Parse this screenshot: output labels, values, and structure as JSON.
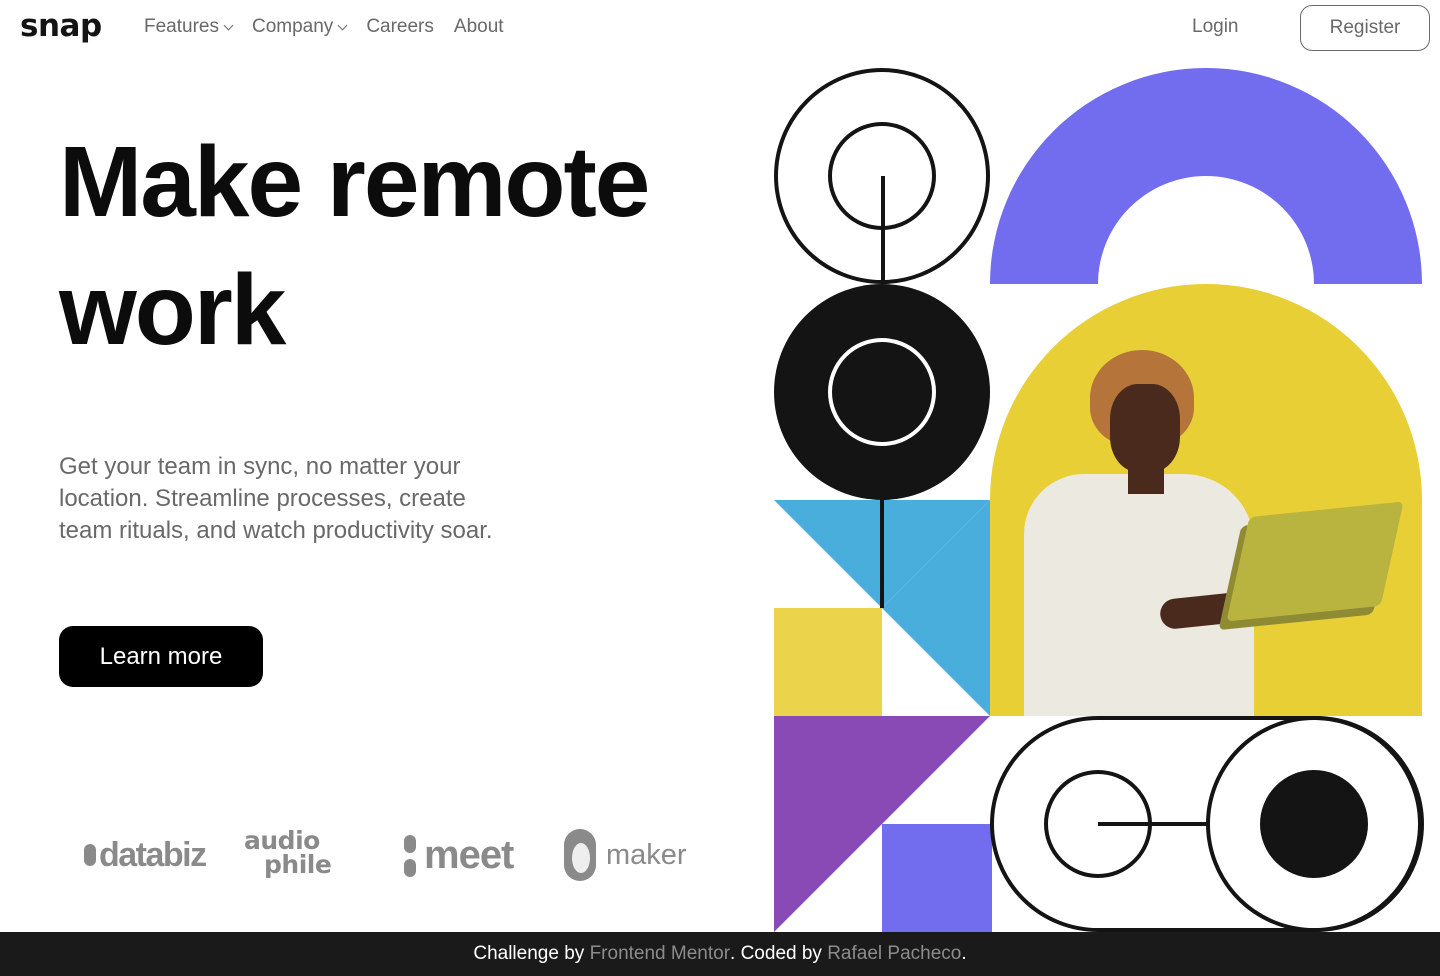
{
  "header": {
    "logo": "snap",
    "nav": [
      {
        "label": "Features",
        "has_dropdown": true
      },
      {
        "label": "Company",
        "has_dropdown": true
      },
      {
        "label": "Careers",
        "has_dropdown": false
      },
      {
        "label": "About",
        "has_dropdown": false
      }
    ],
    "login_label": "Login",
    "register_label": "Register"
  },
  "hero": {
    "title": "Make remote work",
    "description": "Get your team in sync, no matter your location. Streamline processes, create team rituals, and watch productivity soar.",
    "cta_label": "Learn more"
  },
  "clients": {
    "databiz": "databiz",
    "audiophile_top": "audio",
    "audiophile_bottom": "phile",
    "meet": "meet",
    "maker": "maker"
  },
  "footer": {
    "prefix": "Challenge by ",
    "link1": "Frontend Mentor",
    "middle": ". Coded by ",
    "link2": "Rafael Pacheco",
    "suffix": "."
  },
  "colors": {
    "purple": "#726cee",
    "yellow": "#e8cf35",
    "sky": "#4aaedc",
    "violet": "#8a4ab6",
    "dark": "#141414",
    "gray_text": "#696969"
  },
  "icons": [
    "chevron-down-icon",
    "databiz-logo",
    "audiophile-logo",
    "meet-logo",
    "maker-logo"
  ]
}
